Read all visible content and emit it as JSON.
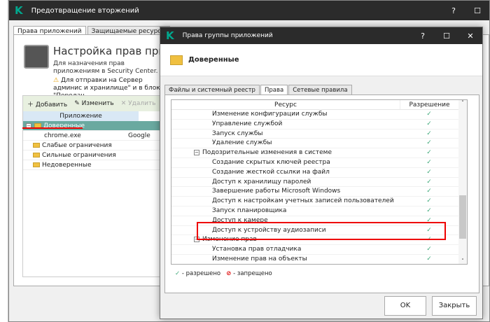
{
  "main_window": {
    "title": "Предотвращение вторжений",
    "tabs": [
      "Права приложений",
      "Защищаемые ресурсы"
    ],
    "heading": "Настройка прав приложе",
    "description": "Для назначения прав приложениям в Security Center.",
    "warning": "Для отправки на Сервер админис и хранилище\" и в блоке \"Передач",
    "toolbar": {
      "add": "Добавить",
      "edit": "Изменить",
      "delete": "Удалить"
    },
    "column": "Приложение",
    "groups": [
      {
        "name": "Доверенные"
      },
      {
        "name": "chrome.exe",
        "vendor": "Google"
      },
      {
        "name": "Слабые ограничения"
      },
      {
        "name": "Сильные ограничения"
      },
      {
        "name": "Недоверенные"
      }
    ]
  },
  "dialog": {
    "title": "Права группы приложений",
    "group": "Доверенные",
    "tabs": [
      "Файлы и системный реестр",
      "Права",
      "Сетевые правила"
    ],
    "columns": {
      "resource": "Ресурс",
      "permission": "Разрешение"
    },
    "rows": [
      {
        "label": "Изменение конфигурации службы",
        "group": false
      },
      {
        "label": "Управление службой",
        "group": false
      },
      {
        "label": "Запуск службы",
        "group": false
      },
      {
        "label": "Удаление службы",
        "group": false
      },
      {
        "label": "Подозрительные изменения в системе",
        "group": true
      },
      {
        "label": "Создание скрытых ключей реестра",
        "group": false
      },
      {
        "label": "Создание жесткой ссылки на файл",
        "group": false
      },
      {
        "label": "Доступ к хранилищу паролей",
        "group": false
      },
      {
        "label": "Завершение работы Microsoft Windows",
        "group": false
      },
      {
        "label": "Доступ к настройкам учетных записей пользователей",
        "group": false
      },
      {
        "label": "Запуск планировщика",
        "group": false
      },
      {
        "label": "Доступ к камере",
        "group": false
      },
      {
        "label": "Доступ к устройству аудиозаписи",
        "group": false
      },
      {
        "label": "Изменение прав",
        "group": true
      },
      {
        "label": "Установка прав отладчика",
        "group": false
      },
      {
        "label": "Изменение прав на объекты",
        "group": false
      }
    ],
    "check": "✓",
    "legend": {
      "allowed": "- разрешено",
      "denied": "- запрещено"
    },
    "buttons": {
      "ok": "OK",
      "close": "Закрыть"
    }
  }
}
